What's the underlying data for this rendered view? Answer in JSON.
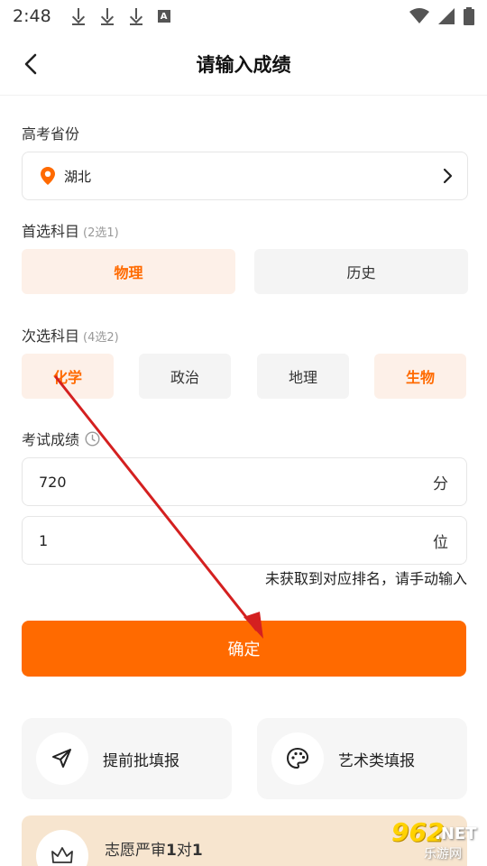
{
  "status_bar": {
    "time": "2:48"
  },
  "nav": {
    "title": "请输入成绩"
  },
  "province": {
    "label": "高考省份",
    "value": "湖北"
  },
  "first_subject": {
    "label": "首选科目",
    "hint": "(2选1)",
    "options": [
      {
        "label": "物理",
        "selected": true
      },
      {
        "label": "历史",
        "selected": false
      }
    ]
  },
  "second_subject": {
    "label": "次选科目",
    "hint": "(4选2)",
    "options": [
      {
        "label": "化学",
        "selected": true
      },
      {
        "label": "政治",
        "selected": false
      },
      {
        "label": "地理",
        "selected": false
      },
      {
        "label": "生物",
        "selected": true
      }
    ]
  },
  "score": {
    "label": "考试成绩",
    "value": "720",
    "unit": "分",
    "rank_value": "1",
    "rank_unit": "位",
    "warning": "未获取到对应排名，请手动输入"
  },
  "confirm_label": "确定",
  "cards": [
    {
      "label": "提前批填报",
      "icon": "send-icon"
    },
    {
      "label": "艺术类填报",
      "icon": "palette-icon"
    }
  ],
  "banner": {
    "title_a": "志愿严审",
    "title_b": "1",
    "title_c": "对",
    "title_d": "1"
  },
  "watermark": {
    "num": "962",
    "net": ".NET",
    "cn": "乐游网"
  },
  "colors": {
    "accent": "#ff6a00",
    "chip_active_bg": "#fdf0e8",
    "arrow": "#d42020"
  }
}
